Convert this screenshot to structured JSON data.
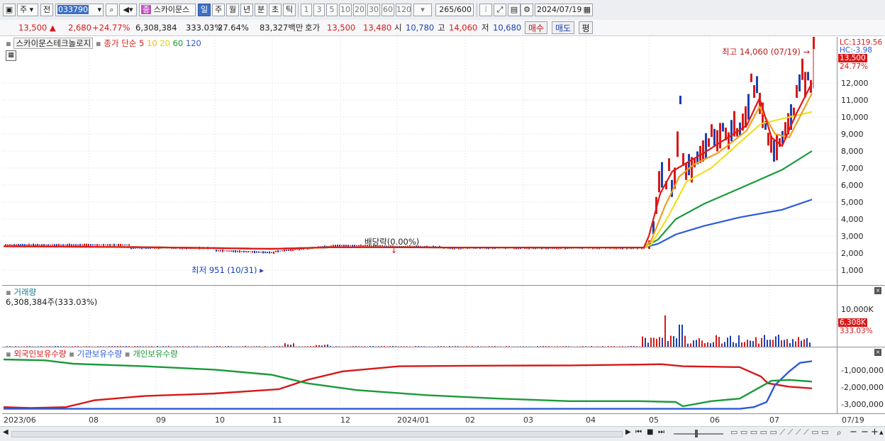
{
  "toolbar": {
    "market": "주",
    "market2": "전",
    "code": "033790",
    "stock_name": "스카이문스",
    "name_badge": "종",
    "periods": [
      "일",
      "주",
      "월",
      "년",
      "분",
      "초",
      "틱"
    ],
    "active_period": "일",
    "intervals": [
      "1",
      "3",
      "5",
      "10",
      "20",
      "30",
      "60",
      "120"
    ],
    "count": "265",
    "count_total": "/600",
    "date": "2024/07/19"
  },
  "quote": {
    "price": "13,500",
    "up_arrow": "▲",
    "change": "2,680",
    "change_pct": "+24.77%",
    "volume": "6,308,384",
    "vol_ratio": "333.03%",
    "turnover": "27.64%",
    "amount": "83,327백만",
    "ask_label": "호가",
    "ask1": "13,500",
    "ask2": "13,480",
    "open_label": "시",
    "open": "10,780",
    "high_label": "고",
    "high": "14,060",
    "low_label": "저",
    "low": "10,680",
    "buy_btn": "매수",
    "sell_btn": "매도",
    "eval_btn": "평"
  },
  "price_panel": {
    "title": "스카이문스테크놀로지",
    "ma_label": "종가 단순",
    "ma": [
      {
        "period": "5",
        "color": "#e01818"
      },
      {
        "period": "10",
        "color": "#f0c000"
      },
      {
        "period": "20",
        "color": "#f0e020"
      },
      {
        "period": "60",
        "color": "#1a9a3a"
      },
      {
        "period": "120",
        "color": "#2a5ad8"
      }
    ],
    "high_annotation": "최고 14,060 (07/19)",
    "low_annotation": "최저 951 (10/31)",
    "dividend_annotation": "배당락(0.00%)",
    "lc": "LC:1319.56",
    "hc": "HC:-3.98",
    "price_tag": "13,500",
    "pct_tag": "24.77%",
    "yticks": [
      "12,000",
      "11,000",
      "10,000",
      "9,000",
      "8,000",
      "7,000",
      "6,000",
      "5,000",
      "4,000",
      "3,000",
      "2,000",
      "1,000"
    ]
  },
  "volume_panel": {
    "title": "거래량",
    "value": "6,308,384주(333.03%)",
    "ytick": "10,000K",
    "vol_tag": "6,308K",
    "pct_tag": "333.03%"
  },
  "holder_panel": {
    "legend": [
      {
        "label": "외국인보유수량",
        "color": "#d81818"
      },
      {
        "label": "기관보유수량",
        "color": "#2a5ad8"
      },
      {
        "label": "개인보유수량",
        "color": "#1a9a3a"
      }
    ],
    "yticks": [
      "-1,000,000",
      "-2,000,000",
      "-3,000,000"
    ]
  },
  "xaxis": {
    "labels": [
      "2023/06",
      "08",
      "09",
      "10",
      "11",
      "12",
      "2024/01",
      "02",
      "03",
      "04",
      "05",
      "06",
      "07"
    ],
    "cursor_date": "07/19"
  },
  "colors": {
    "up": "#d81818",
    "down": "#1a3fb0",
    "selected": "#3d6fc4"
  }
}
